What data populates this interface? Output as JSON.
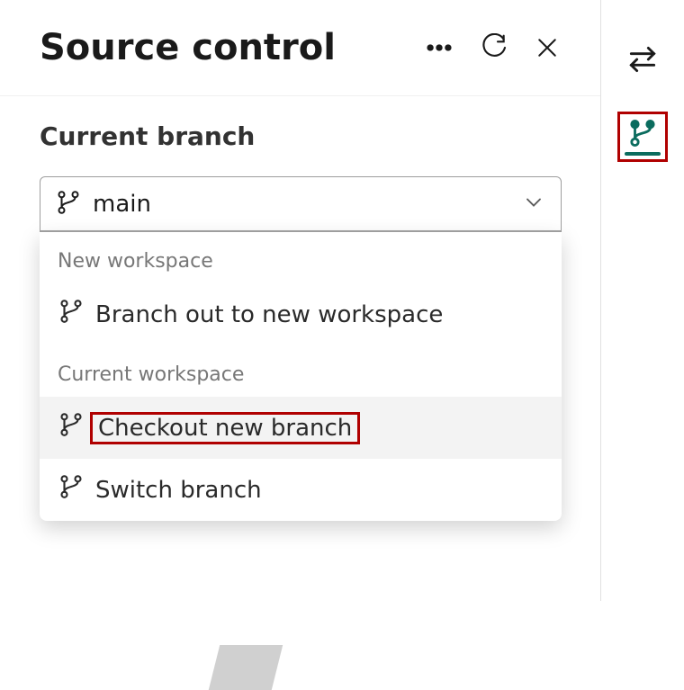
{
  "panel": {
    "title": "Source control"
  },
  "section": {
    "title": "Current branch"
  },
  "branchSelect": {
    "value": "main"
  },
  "dropdown": {
    "group1": {
      "label": "New workspace"
    },
    "item1": {
      "label": "Branch out to new workspace"
    },
    "group2": {
      "label": "Current workspace"
    },
    "item2": {
      "label": "Checkout new branch"
    },
    "item3": {
      "label": "Switch branch"
    }
  },
  "colors": {
    "highlight": "#b00000",
    "git": "#0b6c5e"
  }
}
